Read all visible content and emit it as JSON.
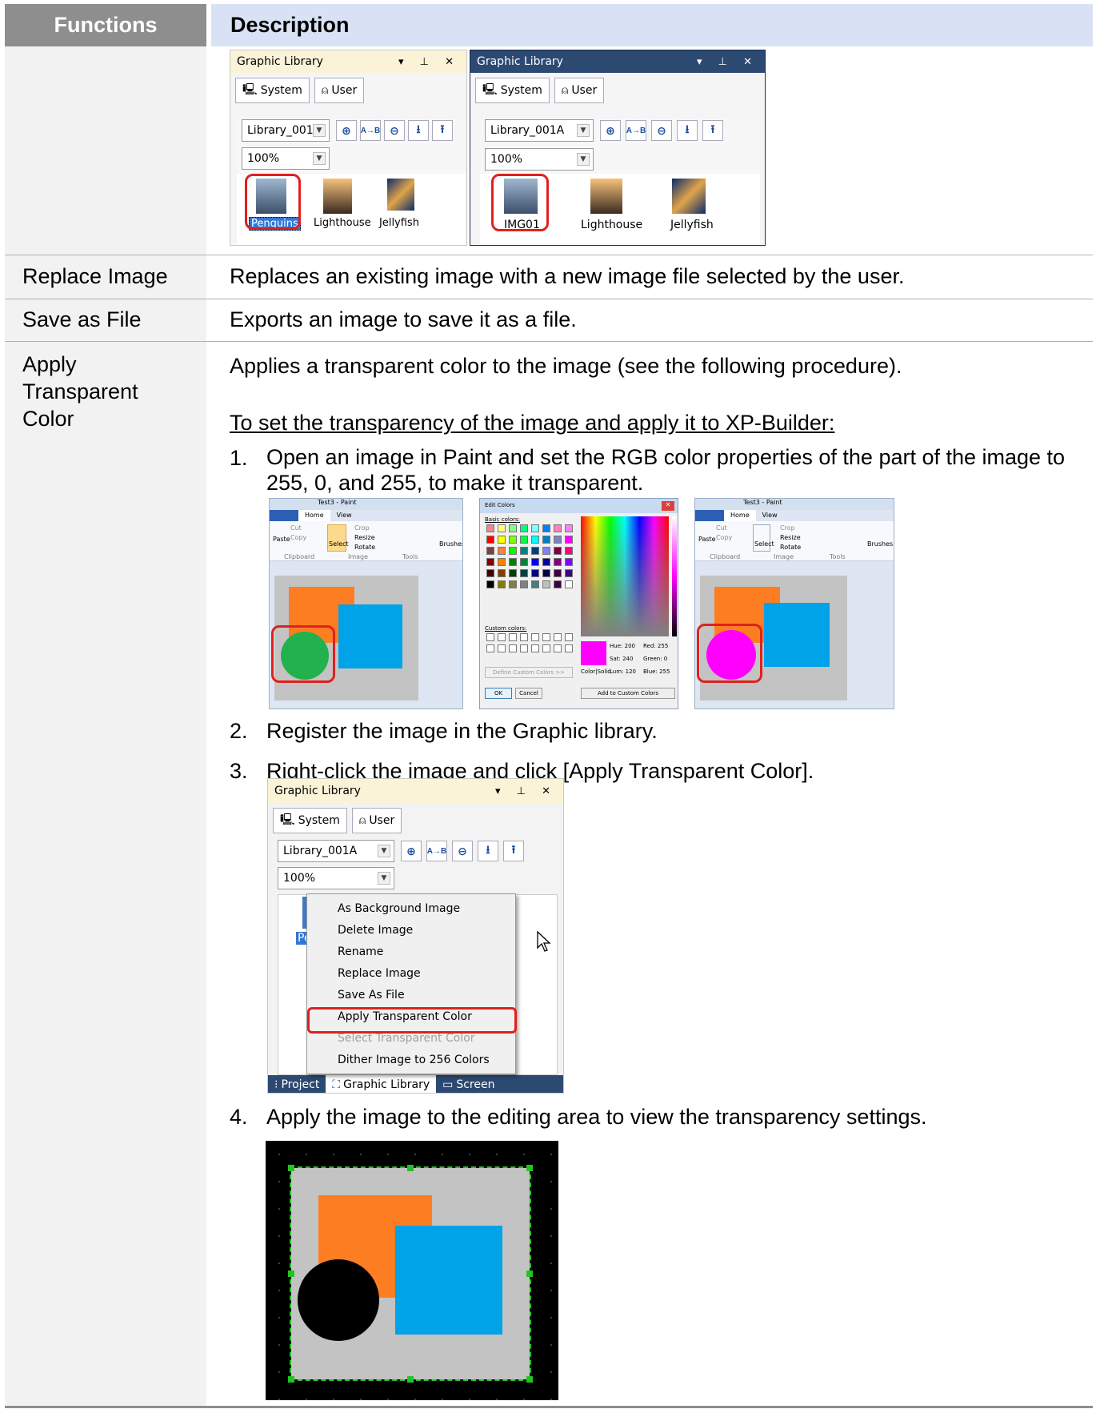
{
  "table": {
    "header_functions": "Functions",
    "header_description": "Description",
    "rows": [
      {
        "function": "Replace Image",
        "description": "Replaces an existing image with a new image file selected by the user."
      },
      {
        "function": "Save as File",
        "description": "Exports an image to save it as a file."
      },
      {
        "function": "Apply Transparent Color",
        "description": "Applies a transparent color to the image (see the following procedure)."
      }
    ]
  },
  "procedure": {
    "heading": "To set the transparency of the image and apply it to XP-Builder:",
    "steps": [
      {
        "num": "1.",
        "text": "Open an image in Paint and set the RGB color properties of the part of the image to 255, 0, and 255, to make it transparent."
      },
      {
        "num": "2.",
        "text": "Register the image in the Graphic library."
      },
      {
        "num": "3.",
        "text": "Right-click the image and click [Apply Transparent Color]."
      },
      {
        "num": "4.",
        "text": "Apply the image to the editing area to view the transparency settings."
      }
    ]
  },
  "graphic_library": {
    "title": "Graphic Library",
    "tab_system": "System",
    "tab_user": "User",
    "library": "Library_001A",
    "zoom": "100%",
    "left_thumbs": [
      "Penguins",
      "Lighthouse",
      "Jellyfish"
    ],
    "right_thumbs": [
      "IMG01",
      "Lighthouse",
      "Jellyfish"
    ],
    "rename_prefix": "Pe"
  },
  "context_menu": {
    "items": [
      {
        "label": "As Background Image",
        "enabled": true
      },
      {
        "label": "Delete Image",
        "enabled": true
      },
      {
        "label": "Rename",
        "enabled": true
      },
      {
        "label": "Replace Image",
        "enabled": true
      },
      {
        "label": "Save As File",
        "enabled": true
      },
      {
        "label": "Apply Transparent Color",
        "enabled": true
      },
      {
        "label": "Select Transparent Color",
        "enabled": false
      },
      {
        "label": "Dither Image to 256 Colors",
        "enabled": true
      }
    ]
  },
  "bottom_tabs": [
    "Project",
    "Graphic Library",
    "Screen"
  ],
  "paint": {
    "title": "Test3 - Paint",
    "tab_home": "Home",
    "tab_view": "View",
    "paste": "Paste",
    "cut": "Cut",
    "copy": "Copy",
    "select": "Select",
    "crop": "Crop",
    "resize": "Resize",
    "rotate": "Rotate",
    "brushes": "Brushes",
    "group_clipboard": "Clipboard",
    "group_image": "Image",
    "group_tools": "Tools"
  },
  "edit_colors": {
    "title": "Edit Colors",
    "basic_colors": "Basic colors:",
    "custom_colors": "Custom colors:",
    "define_button": "Define Custom Colors >>",
    "ok": "OK",
    "cancel": "Cancel",
    "add_button": "Add to Custom Colors",
    "color_solid": "Color|Solid",
    "hue_label": "Hue:",
    "hue": "200",
    "sat_label": "Sat:",
    "sat": "240",
    "lum_label": "Lum:",
    "lum": "120",
    "red_label": "Red:",
    "red": "255",
    "green_label": "Green:",
    "green": "0",
    "blue_label": "Blue:",
    "blue": "255"
  },
  "colors": {
    "header_desc_bg": "#d9e2f5",
    "header_func_bg": "#8e8e8e",
    "highlight_red": "#e0201e",
    "shape_orange": "#fd7e22",
    "shape_blue": "#00a2e8",
    "shape_green": "#22b14c",
    "shape_magenta": "#ff00ff",
    "canvas_gray": "#c3c3c3"
  }
}
